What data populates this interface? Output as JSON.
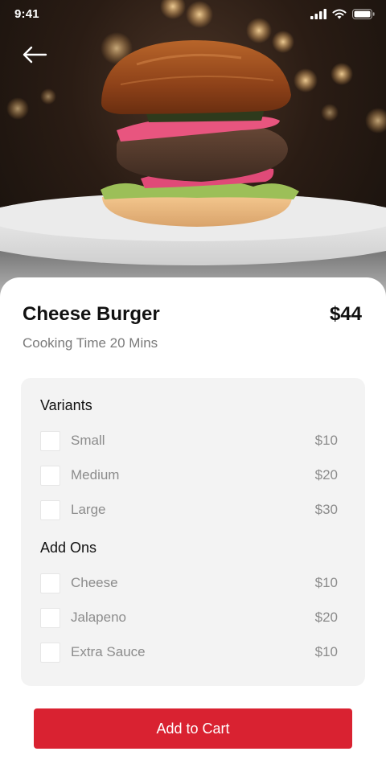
{
  "status_bar": {
    "time": "9:41"
  },
  "hero": {
    "image_subject": "cheese burger on white plate"
  },
  "dish": {
    "name": "Cheese Burger",
    "price": "$44",
    "cooking_time": "Cooking Time 20 Mins"
  },
  "variants": {
    "title": "Variants",
    "items": [
      {
        "label": "Small",
        "price": "$10",
        "checked": false
      },
      {
        "label": "Medium",
        "price": "$20",
        "checked": false
      },
      {
        "label": "Large",
        "price": "$30",
        "checked": false
      }
    ]
  },
  "addons": {
    "title": "Add Ons",
    "items": [
      {
        "label": "Cheese",
        "price": "$10",
        "checked": false
      },
      {
        "label": "Jalapeno",
        "price": "$20",
        "checked": false
      },
      {
        "label": "Extra Sauce",
        "price": "$10",
        "checked": false
      }
    ]
  },
  "cart_button": {
    "label": "Add to Cart"
  },
  "colors": {
    "accent": "#d92231",
    "card_bg": "#f3f3f3",
    "muted_text": "#8c8c8c"
  },
  "icons": [
    "back-arrow-icon",
    "signal-icon",
    "wifi-icon",
    "battery-icon"
  ]
}
